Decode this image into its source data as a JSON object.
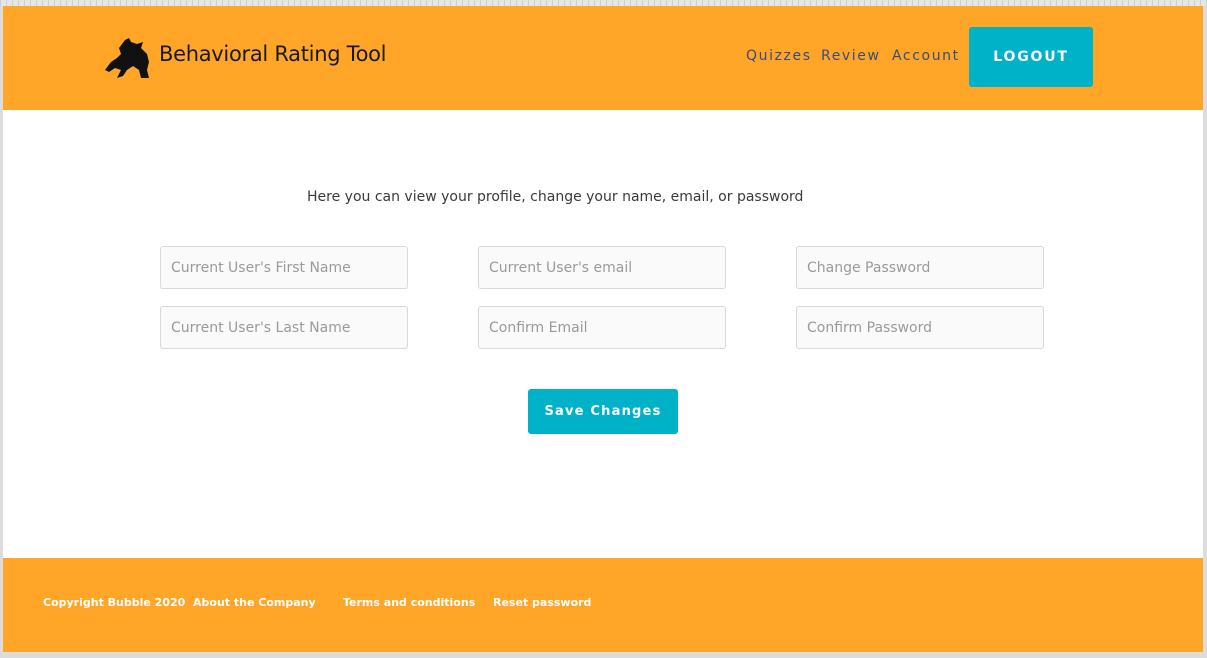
{
  "header": {
    "title": "Behavioral Rating Tool",
    "nav": [
      "Quizzes",
      "Review",
      "Account"
    ],
    "logout_label": "LOGOUT"
  },
  "main": {
    "intro": "Here you can view your profile, change your name, email, or password",
    "fields": {
      "first_name": "Current User's First Name",
      "last_name": "Current User's Last Name",
      "email": "Current User's email",
      "confirm_email": "Confirm Email",
      "change_password": "Change Password",
      "confirm_password": "Confirm Password"
    },
    "save_label": "Save Changes"
  },
  "footer": {
    "items": [
      "Copyright Bubble 2020",
      "About the Company",
      "Terms and conditions",
      "Reset password"
    ]
  },
  "colors": {
    "brand_orange": "#ffa628",
    "accent_teal": "#00b2c8",
    "nav_text": "#3b4a7a"
  },
  "icons": {
    "logo": "horse-silhouette-icon"
  }
}
